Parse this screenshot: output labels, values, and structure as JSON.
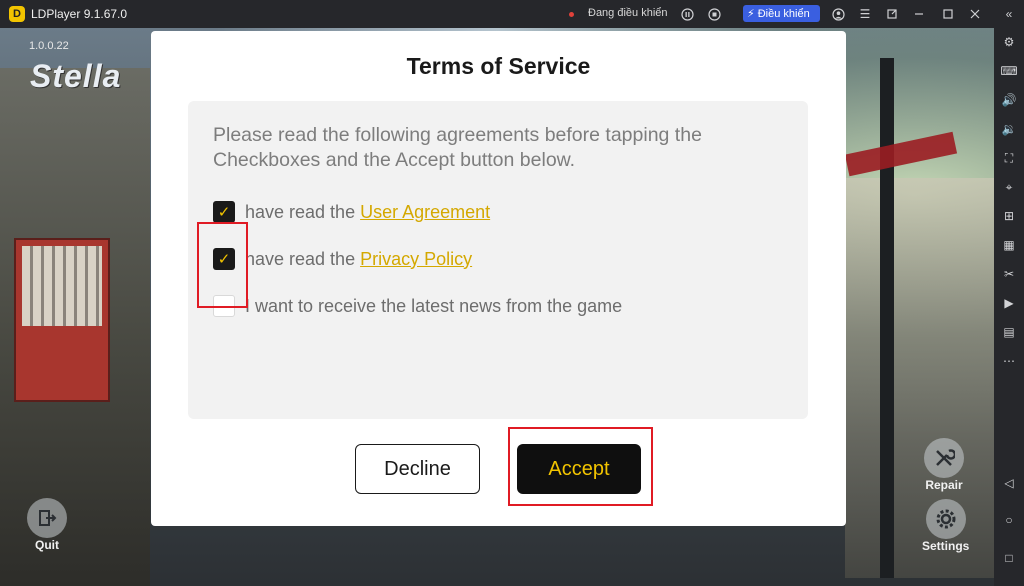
{
  "titlebar": {
    "app_title": "LDPlayer 9.1.67.0",
    "status_text": "Đang điều khiển",
    "control_button_label": "Điều khiển",
    "icons": [
      "pause-icon",
      "stop-icon",
      "user-icon",
      "menu-icon",
      "restore-icon",
      "minimize-icon",
      "maximize-icon",
      "close-icon",
      "collapse-icon"
    ]
  },
  "game": {
    "version": "1.0.0.22",
    "logo_text": "Stella",
    "quit_label": "Quit",
    "repair_label": "Repair",
    "settings_label": "Settings"
  },
  "dialog": {
    "title": "Terms of Service",
    "intro": "Please read the following agreements before tapping the Checkboxes and the Accept button below.",
    "checks": [
      {
        "prefix": "have read the ",
        "link": "User Agreement",
        "checked": true
      },
      {
        "prefix": "have read the ",
        "link": "Privacy Policy",
        "checked": true
      },
      {
        "prefix": "I want to receive the latest news from the game",
        "link": "",
        "checked": false
      }
    ],
    "decline_label": "Decline",
    "accept_label": "Accept"
  },
  "right_toolbar": {
    "icons": [
      "settings-gear-icon",
      "keyboard-icon",
      "volume-up-icon",
      "volume-down-icon",
      "fullscreen-icon",
      "location-icon",
      "add-app-icon",
      "multi-instance-icon",
      "scissors-icon",
      "record-icon",
      "files-icon",
      "more-icon",
      "back-icon",
      "home-icon",
      "recent-apps-icon"
    ]
  },
  "colors": {
    "accent_yellow": "#f2c400",
    "highlight_red": "#e01b24",
    "link_yellow": "#d4a800"
  }
}
